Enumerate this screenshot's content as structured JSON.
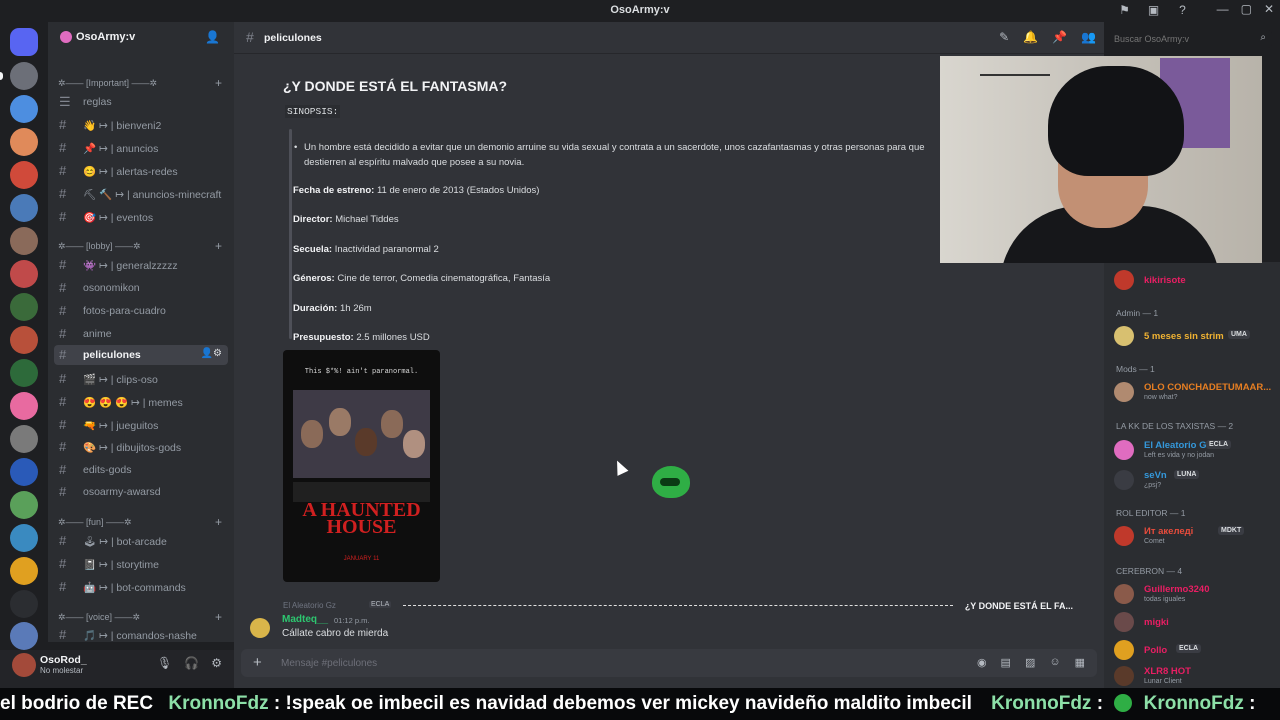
{
  "app": {
    "window_title": "OsoArmy:v"
  },
  "guild": {
    "name": "OsoArmy:v"
  },
  "categories": [
    {
      "label": "✲—— [Important] ——✲"
    },
    {
      "label": "✲—— [lobby] ——✲"
    },
    {
      "label": "✲—— [fun] ——✲"
    },
    {
      "label": "✲—— [voice] ——✲"
    }
  ],
  "channels": [
    {
      "label": "reglas"
    },
    {
      "label": "👋 ↦ | bienveni2"
    },
    {
      "label": "📌 ↦ | anuncios"
    },
    {
      "label": "😊 ↦ | alertas-redes"
    },
    {
      "label": "⛏ 🔨 ↦ | anuncios-minecraft"
    },
    {
      "label": "🎯 ↦ | eventos"
    },
    {
      "label": "👾 ↦ | generalzzzzz"
    },
    {
      "label": "osonomikon"
    },
    {
      "label": "fotos-para-cuadro"
    },
    {
      "label": "anime"
    },
    {
      "label": "peliculones"
    },
    {
      "label": "🎬 ↦ | clips-oso"
    },
    {
      "label": "😍 😍 😍 ↦ | memes"
    },
    {
      "label": "🔫 ↦ | jueguitos"
    },
    {
      "label": "🎨 ↦ | dibujitos-gods"
    },
    {
      "label": "edits-gods"
    },
    {
      "label": "osoarmy-awarsd"
    },
    {
      "label": "🕹 ↦ | bot-arcade"
    },
    {
      "label": "📓 ↦ | storytime"
    },
    {
      "label": "🤖 ↦ | bot-commands"
    },
    {
      "label": "🎵 ↦ | comandos-nashe"
    }
  ],
  "user_panel": {
    "username": "OsoRod_",
    "status": "No molestar"
  },
  "chat": {
    "channel_name": "peliculones",
    "search_placeholder": "Buscar OsoArmy:v",
    "composer_placeholder": "Mensaje #peliculones",
    "movie": {
      "title": "¿Y DONDE ESTÁ EL FANTASMA?",
      "synopsis_label": "SINOPSIS:",
      "synopsis": "Un hombre está decidido a evitar que un demonio arruine su vida sexual y contrata a un sacerdote, unos cazafantasmas y otras personas para que destierren al espíritu malvado que posee a su novia.",
      "fields": [
        {
          "key": "Fecha de estreno:",
          "value": "11 de enero de 2013 (Estados Unidos)"
        },
        {
          "key": "Director:",
          "value": "Michael Tiddes"
        },
        {
          "key": "Secuela:",
          "value": "Inactividad paranormal 2"
        },
        {
          "key": "Géneros:",
          "value": "Cine de terror, Comedia cinematográfica, Fantasía"
        },
        {
          "key": "Duración:",
          "value": "1h 26m"
        },
        {
          "key": "Presupuesto:",
          "value": "2.5 millones USD"
        }
      ],
      "poster": {
        "tagline": "This $*%! ain't paranormal.",
        "title": "A HAUNTED HOUSE",
        "date": "JANUARY 11"
      }
    },
    "reply": {
      "ref_user": "El Aleatorio Gz",
      "ref_badge": "ECLA",
      "ref_text": "¿Y DONDE ESTÁ EL FA...",
      "author": "Madteq__",
      "time": "01:12 p.m.",
      "text": "Cállate cabro de mierda"
    }
  },
  "members": {
    "top_user": "kikirisote",
    "groups": [
      {
        "label": "Admin — 1"
      },
      {
        "label": "Mods — 1"
      },
      {
        "label": "LA KK DE LOS TAXISTAS — 2"
      },
      {
        "label": "ROL EDITOR — 1"
      },
      {
        "label": "CEREBRON — 4"
      }
    ],
    "users": [
      {
        "name": "5 meses sin strim",
        "badge": "UMA",
        "status": ""
      },
      {
        "name": "OLO CONCHADETUMAAR...",
        "badge": "",
        "status": "now what?"
      },
      {
        "name": "El Aleatorio Gz",
        "badge": "ECLA",
        "status": "Left es vida y no jodan"
      },
      {
        "name": "seVn",
        "badge": "LUNA",
        "status": "¿psj?"
      },
      {
        "name": "Ит акеледі",
        "badge": "MDKT",
        "status": "Comet"
      },
      {
        "name": "Guillermo3240",
        "badge": "",
        "status": "todas iguales"
      },
      {
        "name": "migki",
        "badge": "",
        "status": ""
      },
      {
        "name": "Pollo",
        "badge": "ECLA",
        "status": ""
      },
      {
        "name": "XLR8 HOT",
        "badge": "",
        "status": "Lunar Client"
      }
    ]
  },
  "ticker": {
    "segments": [
      {
        "kind": "w",
        "text": "el bodrio de REC"
      },
      {
        "kind": "n",
        "text": "KronnoFdz"
      },
      {
        "kind": "w",
        "text": ": !speak oe imbecil es navidad debemos ver mickey navideño maldito imbecil"
      },
      {
        "kind": "n",
        "text": "KronnoFdz"
      },
      {
        "kind": "w",
        "text": ":"
      },
      {
        "kind": "n",
        "text": "KronnoFdz"
      },
      {
        "kind": "w",
        "text": ":"
      }
    ]
  },
  "colors": {
    "accent": "#5865f2",
    "admin_name": "#f0b232",
    "mods_name": "#e67e22",
    "taxistas_name": "#3498db",
    "rol_editor_name": "#e74c3c",
    "cerebron_name": "#e91e63",
    "reply_author": "#2dc770"
  }
}
